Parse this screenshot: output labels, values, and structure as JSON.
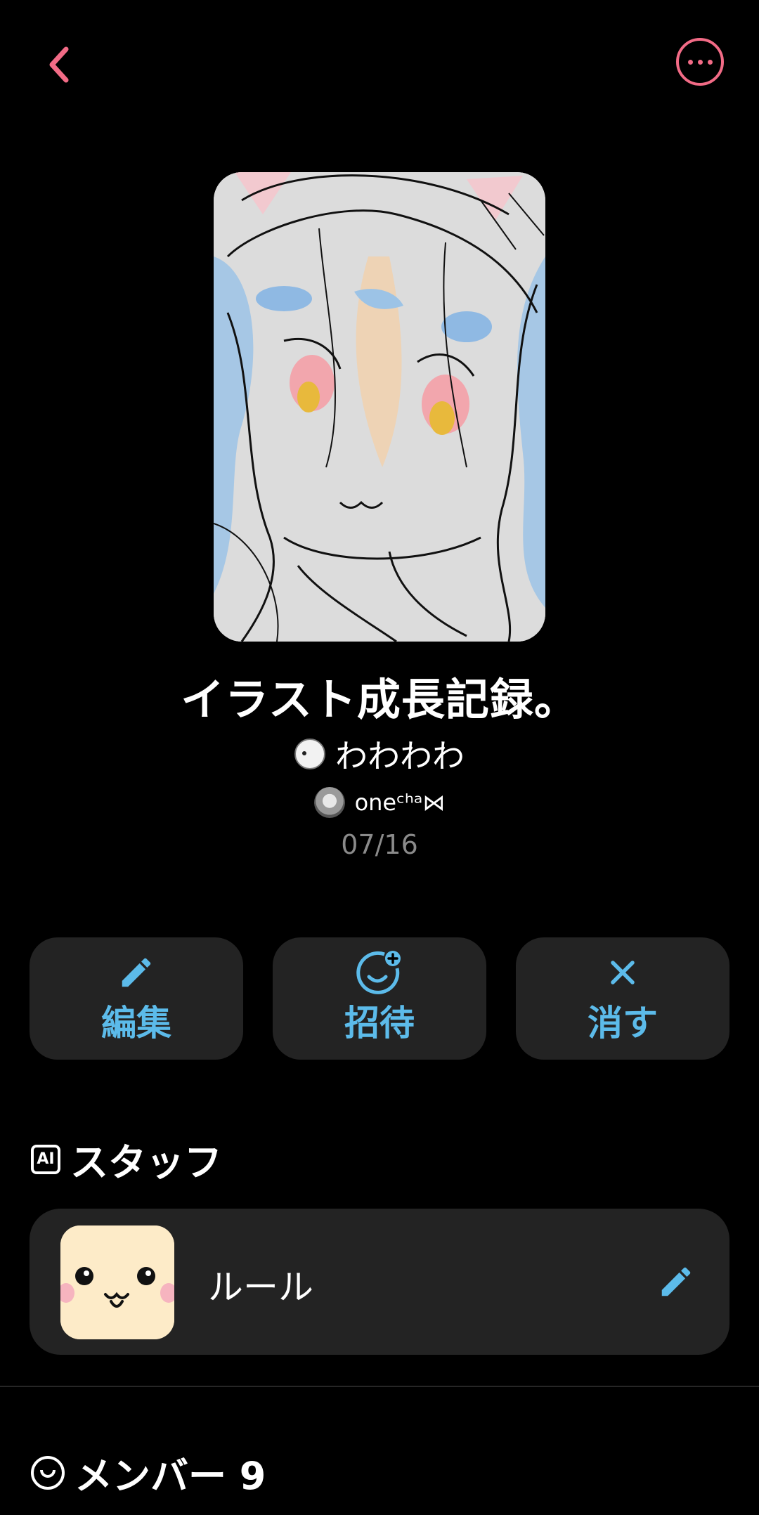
{
  "colors": {
    "accent_pink": "#f26b86",
    "accent_blue": "#5cbbea",
    "card_bg": "#232323",
    "muted": "#8a8a8a"
  },
  "topbar": {
    "back_icon": "chevron-left-icon",
    "more_icon": "more-horizontal-icon"
  },
  "room": {
    "title": "イラスト成長記録。",
    "owner_name": "わわわわ",
    "creator_name": "oneᶜʰᵃ⋈",
    "date": "07/16"
  },
  "actions": {
    "edit_label": "編集",
    "invite_label": "招待",
    "delete_label": "消す"
  },
  "staff": {
    "section_badge": "AI",
    "section_title": "スタッフ",
    "items": [
      {
        "name": "ルール"
      }
    ]
  },
  "members": {
    "section_title": "メンバー 9"
  }
}
